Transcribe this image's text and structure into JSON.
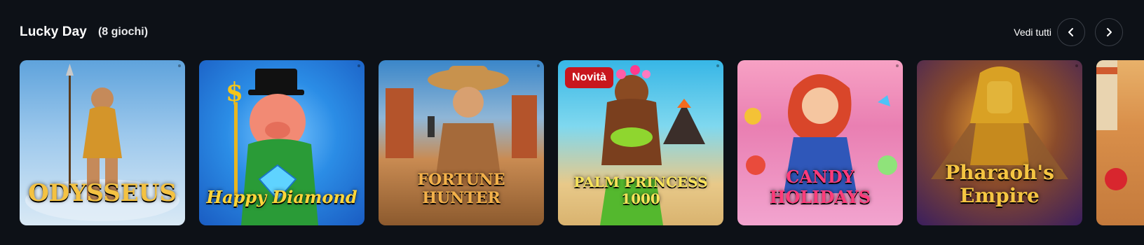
{
  "section": {
    "title": "Lucky Day",
    "count": "(8 giochi)",
    "see_all": "Vedi tutti",
    "prev_icon": "chevron-left-icon",
    "next_icon": "chevron-right-icon"
  },
  "games": [
    {
      "name": "ODYSSEUS",
      "badge": ""
    },
    {
      "name": "Happy Diamond",
      "badge": ""
    },
    {
      "name": "FORTUNE HUNTER",
      "badge": ""
    },
    {
      "name": "PALM PRINCESS 1000",
      "badge": "Novità"
    },
    {
      "name": "CANDY HOLIDAYS",
      "badge": ""
    },
    {
      "name": "Pharaoh's Empire",
      "badge": ""
    },
    {
      "name": "",
      "badge": ""
    }
  ]
}
